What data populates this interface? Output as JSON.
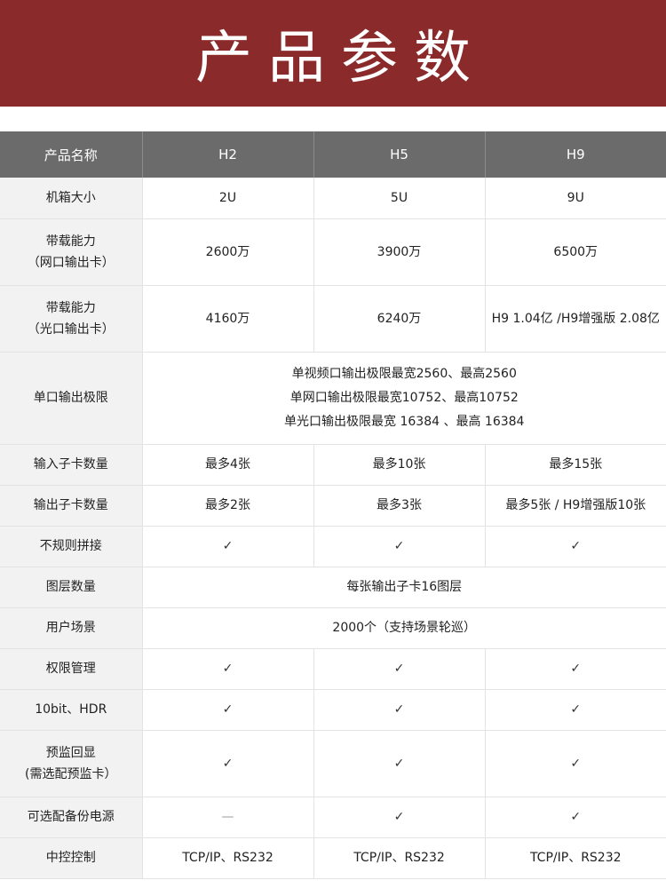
{
  "banner": {
    "title": "产品参数"
  },
  "table": {
    "headers": [
      "产品名称",
      "H2",
      "H5",
      "H9"
    ],
    "rows": [
      {
        "label": [
          "机箱大小"
        ],
        "cells": [
          "2U",
          "5U",
          "9U"
        ]
      },
      {
        "label": [
          "带载能力",
          "（网口输出卡）"
        ],
        "cells": [
          "2600万",
          "3900万",
          "6500万"
        ]
      },
      {
        "label": [
          "带载能力",
          "（光口输出卡）"
        ],
        "cells": [
          "4160万",
          "6240万",
          "H9 1.04亿 /H9增强版 2.08亿"
        ]
      },
      {
        "label": [
          "单口输出极限"
        ],
        "merged": [
          "单视频口输出极限最宽2560、最高2560",
          "单网口输出极限最宽10752、最高10752",
          "单光口输出极限最宽 16384 、最高 16384"
        ]
      },
      {
        "label": [
          "输入子卡数量"
        ],
        "cells": [
          "最多4张",
          "最多10张",
          "最多15张"
        ]
      },
      {
        "label": [
          "输出子卡数量"
        ],
        "cells": [
          "最多2张",
          "最多3张",
          "最多5张 / H9增强版10张"
        ]
      },
      {
        "label": [
          "不规则拼接"
        ],
        "cells": [
          "✓",
          "✓",
          "✓"
        ]
      },
      {
        "label": [
          "图层数量"
        ],
        "merged": [
          "每张输出子卡16图层"
        ]
      },
      {
        "label": [
          "用户场景"
        ],
        "merged": [
          "2000个（支持场景轮巡）"
        ]
      },
      {
        "label": [
          "权限管理"
        ],
        "cells": [
          "✓",
          "✓",
          "✓"
        ]
      },
      {
        "label": [
          "10bit、HDR"
        ],
        "cells": [
          "✓",
          "✓",
          "✓"
        ]
      },
      {
        "label": [
          "预监回显",
          "(需选配预监卡）"
        ],
        "cells": [
          "✓",
          "✓",
          "✓"
        ]
      },
      {
        "label": [
          "可选配备份电源"
        ],
        "cells": [
          "—",
          "✓",
          "✓"
        ]
      },
      {
        "label": [
          "中控控制"
        ],
        "cells": [
          "TCP/IP、RS232",
          "TCP/IP、RS232",
          "TCP/IP、RS232"
        ]
      }
    ]
  }
}
